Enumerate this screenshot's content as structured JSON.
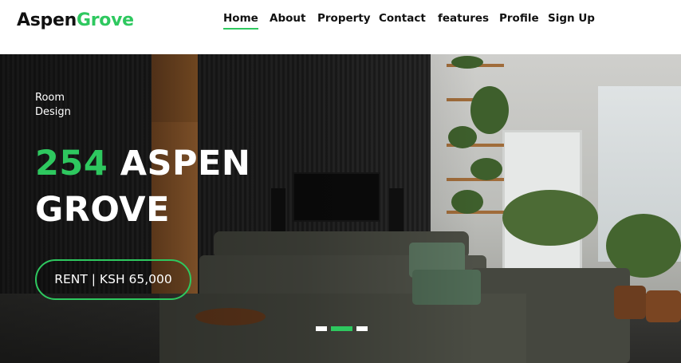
{
  "brand": {
    "part1": "Aspen",
    "part2": "Grove"
  },
  "nav": {
    "items": [
      {
        "label": "Home",
        "active": true
      },
      {
        "label": "About"
      },
      {
        "label": "Property"
      },
      {
        "label": "Contact"
      },
      {
        "label": "features"
      },
      {
        "label": "Profile"
      },
      {
        "label": "Sign Up"
      }
    ]
  },
  "hero": {
    "eyebrow_line1": "Room",
    "eyebrow_line2": "Design",
    "title_number": "254",
    "title_rest1": "ASPEN",
    "title_rest2": "GROVE",
    "rent_label": "RENT | KSH 65,000",
    "slides": {
      "count": 3,
      "active_index": 1
    }
  },
  "colors": {
    "accent": "#2ec85f",
    "text_dark": "#111111",
    "text_light": "#ffffff"
  }
}
